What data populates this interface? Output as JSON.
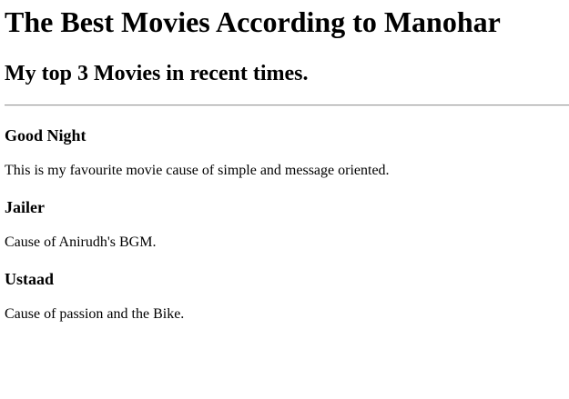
{
  "page": {
    "heading": "The Best Movies According to Manohar",
    "subheading": "My top 3 Movies in recent times."
  },
  "movies": [
    {
      "title": "Good Night",
      "description": "This is my favourite movie cause of simple and message oriented."
    },
    {
      "title": "Jailer",
      "description": "Cause of Anirudh's BGM."
    },
    {
      "title": "Ustaad",
      "description": "Cause of passion and the Bike."
    }
  ]
}
